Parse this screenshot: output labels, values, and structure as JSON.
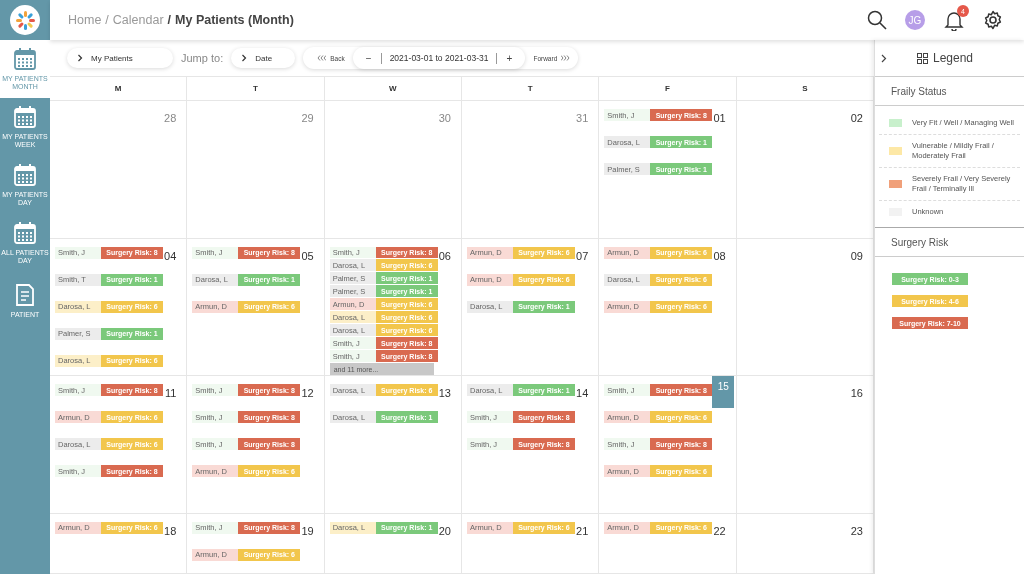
{
  "sidebar": {
    "items": [
      {
        "label": "MY PATIENTS MONTH",
        "selected": true,
        "kind": "calendar"
      },
      {
        "label": "MY PATIENTS WEEK",
        "selected": false,
        "kind": "calendar"
      },
      {
        "label": "MY PATIENTS DAY",
        "selected": false,
        "kind": "calendar"
      },
      {
        "label": "ALL PATIENTS DAY",
        "selected": false,
        "kind": "calendar"
      },
      {
        "label": "PATIENT",
        "selected": false,
        "kind": "document"
      }
    ]
  },
  "breadcrumb": [
    {
      "label": "Home",
      "current": false
    },
    {
      "separator": "/",
      "label": "Calendar",
      "current": false
    },
    {
      "separator": "/",
      "label": "My Patients (Month)",
      "current": true
    }
  ],
  "header": {
    "avatar": "JG",
    "notifications": "4"
  },
  "toolbar": {
    "view": "My Patients",
    "jump_label": "Jump to:",
    "jump": "Date",
    "back": "Back",
    "minus": "−",
    "range": "2021-03-01 to 2021-03-31",
    "plus": "+",
    "forward": "Forward"
  },
  "weekdays": [
    "M",
    "T",
    "W",
    "T",
    "F",
    "S"
  ],
  "weeks": [
    {
      "days": [
        {
          "date": "28",
          "muted": true,
          "today": false
        },
        {
          "date": "29",
          "muted": true,
          "today": false
        },
        {
          "date": "30",
          "muted": true,
          "today": false
        },
        {
          "date": "31",
          "muted": true,
          "today": false
        },
        {
          "date": "01",
          "muted": false,
          "today": false,
          "entries": [
            {
              "name": {
                "text": "Smith, J",
                "color": "#f0f9f0"
              },
              "risk": {
                "text": "Surgery Risk: 8",
                "color": "#d96a50"
              }
            },
            {
              "name": {
                "text": "Darosa, L",
                "color": "#ececec"
              },
              "risk": {
                "text": "Surgery Risk: 1",
                "color": "#7bc97b"
              }
            },
            {
              "name": {
                "text": "Palmer, S",
                "color": "#ececec"
              },
              "risk": {
                "text": "Surgery Risk: 1",
                "color": "#7bc97b"
              }
            }
          ]
        },
        {
          "date": "02",
          "muted": false,
          "today": false
        }
      ]
    },
    {
      "days": [
        {
          "date": "04",
          "muted": false,
          "today": false,
          "entries": [
            {
              "name": {
                "text": "Smith, J",
                "color": "#f0f9f0"
              },
              "risk": {
                "text": "Surgery Risk: 8",
                "color": "#d96a50"
              }
            },
            {
              "name": {
                "text": "Smith, T",
                "color": "#ececec"
              },
              "risk": {
                "text": "Surgery Risk: 1",
                "color": "#7bc97b"
              }
            },
            {
              "name": {
                "text": "Darosa, L",
                "color": "#fcefc8"
              },
              "risk": {
                "text": "Surgery Risk: 6",
                "color": "#f2c64c"
              }
            },
            {
              "name": {
                "text": "Palmer, S",
                "color": "#ececec"
              },
              "risk": {
                "text": "Surgery Risk: 1",
                "color": "#7bc97b"
              }
            },
            {
              "name": {
                "text": "Darosa, L",
                "color": "#fcefc8"
              },
              "risk": {
                "text": "Surgery Risk: 6",
                "color": "#f2c64c"
              }
            }
          ]
        },
        {
          "date": "05",
          "muted": false,
          "today": false,
          "entries": [
            {
              "name": {
                "text": "Smith, J",
                "color": "#f0f9f0"
              },
              "risk": {
                "text": "Surgery Risk: 8",
                "color": "#d96a50"
              }
            },
            {
              "name": {
                "text": "Darosa, L",
                "color": "#ececec"
              },
              "risk": {
                "text": "Surgery Risk: 1",
                "color": "#7bc97b"
              }
            },
            {
              "name": {
                "text": "Armun, D",
                "color": "#f9dad5"
              },
              "risk": {
                "text": "Surgery Risk: 6",
                "color": "#f2c64c"
              }
            }
          ]
        },
        {
          "date": "06",
          "muted": false,
          "today": false,
          "more": "and 11 more...",
          "entries": [
            {
              "name": {
                "text": "Smith, J",
                "color": "#f0f9f0"
              },
              "risk": {
                "text": "Surgery Risk: 8",
                "color": "#d96a50"
              }
            },
            {
              "name": {
                "text": "Darosa, L",
                "color": "#ececec"
              },
              "risk": {
                "text": "Surgery Risk: 6",
                "color": "#f2c64c"
              }
            },
            {
              "name": {
                "text": "Palmer, S",
                "color": "#ececec"
              },
              "risk": {
                "text": "Surgery Risk: 1",
                "color": "#7bc97b"
              }
            },
            {
              "name": {
                "text": "Palmer, S",
                "color": "#ececec"
              },
              "risk": {
                "text": "Surgery Risk: 1",
                "color": "#7bc97b"
              }
            },
            {
              "name": {
                "text": "Armun, D",
                "color": "#f9dad5"
              },
              "risk": {
                "text": "Surgery Risk: 6",
                "color": "#f2c64c"
              }
            },
            {
              "name": {
                "text": "Darosa, L",
                "color": "#fcefc8"
              },
              "risk": {
                "text": "Surgery Risk: 6",
                "color": "#f2c64c"
              }
            },
            {
              "name": {
                "text": "Darosa, L",
                "color": "#ececec"
              },
              "risk": {
                "text": "Surgery Risk: 6",
                "color": "#f2c64c"
              }
            },
            {
              "name": {
                "text": "Smith, J",
                "color": "#f0f9f0"
              },
              "risk": {
                "text": "Surgery Risk: 8",
                "color": "#d96a50"
              }
            },
            {
              "name": {
                "text": "Smith, J",
                "color": "#f0f9f0"
              },
              "risk": {
                "text": "Surgery Risk: 8",
                "color": "#d96a50"
              }
            }
          ]
        },
        {
          "date": "07",
          "muted": false,
          "today": false,
          "entries": [
            {
              "name": {
                "text": "Armun, D",
                "color": "#f9dad5"
              },
              "risk": {
                "text": "Surgery Risk: 6",
                "color": "#f2c64c"
              }
            },
            {
              "name": {
                "text": "Armun, D",
                "color": "#f9dad5"
              },
              "risk": {
                "text": "Surgery Risk: 6",
                "color": "#f2c64c"
              }
            },
            {
              "name": {
                "text": "Darosa, L",
                "color": "#ececec"
              },
              "risk": {
                "text": "Surgery Risk: 1",
                "color": "#7bc97b"
              }
            }
          ]
        },
        {
          "date": "08",
          "muted": false,
          "today": false,
          "entries": [
            {
              "name": {
                "text": "Armun, D",
                "color": "#f9dad5"
              },
              "risk": {
                "text": "Surgery Risk: 6",
                "color": "#f2c64c"
              }
            },
            {
              "name": {
                "text": "Darosa, L",
                "color": "#ececec"
              },
              "risk": {
                "text": "Surgery Risk: 6",
                "color": "#f2c64c"
              }
            },
            {
              "name": {
                "text": "Armun, D",
                "color": "#f9dad5"
              },
              "risk": {
                "text": "Surgery Risk: 6",
                "color": "#f2c64c"
              }
            }
          ]
        },
        {
          "date": "09",
          "muted": false,
          "today": false
        }
      ]
    },
    {
      "days": [
        {
          "date": "11",
          "muted": false,
          "today": false,
          "entries": [
            {
              "name": {
                "text": "Smith, J",
                "color": "#f0f9f0"
              },
              "risk": {
                "text": "Surgery Risk: 8",
                "color": "#d96a50"
              }
            },
            {
              "name": {
                "text": "Armun, D",
                "color": "#f9dad5"
              },
              "risk": {
                "text": "Surgery Risk: 6",
                "color": "#f2c64c"
              }
            },
            {
              "name": {
                "text": "Darosa, L",
                "color": "#ececec"
              },
              "risk": {
                "text": "Surgery Risk: 6",
                "color": "#f2c64c"
              }
            },
            {
              "name": {
                "text": "Smith, J",
                "color": "#f0f9f0"
              },
              "risk": {
                "text": "Surgery Risk: 8",
                "color": "#d96a50"
              }
            }
          ]
        },
        {
          "date": "12",
          "muted": false,
          "today": false,
          "entries": [
            {
              "name": {
                "text": "Smith, J",
                "color": "#f0f9f0"
              },
              "risk": {
                "text": "Surgery Risk: 8",
                "color": "#d96a50"
              }
            },
            {
              "name": {
                "text": "Smith, J",
                "color": "#f0f9f0"
              },
              "risk": {
                "text": "Surgery Risk: 8",
                "color": "#d96a50"
              }
            },
            {
              "name": {
                "text": "Smith, J",
                "color": "#f0f9f0"
              },
              "risk": {
                "text": "Surgery Risk: 8",
                "color": "#d96a50"
              }
            },
            {
              "name": {
                "text": "Armun, D",
                "color": "#f9dad5"
              },
              "risk": {
                "text": "Surgery Risk: 6",
                "color": "#f2c64c"
              }
            }
          ]
        },
        {
          "date": "13",
          "muted": false,
          "today": false,
          "entries": [
            {
              "name": {
                "text": "Darosa, L",
                "color": "#ececec"
              },
              "risk": {
                "text": "Surgery Risk: 6",
                "color": "#f2c64c"
              }
            },
            {
              "name": {
                "text": "Darosa, L",
                "color": "#ececec"
              },
              "risk": {
                "text": "Surgery Risk: 1",
                "color": "#7bc97b"
              }
            }
          ]
        },
        {
          "date": "14",
          "muted": false,
          "today": false,
          "entries": [
            {
              "name": {
                "text": "Darosa, L",
                "color": "#ececec"
              },
              "risk": {
                "text": "Surgery Risk: 1",
                "color": "#7bc97b"
              }
            },
            {
              "name": {
                "text": "Smith, J",
                "color": "#f0f9f0"
              },
              "risk": {
                "text": "Surgery Risk: 8",
                "color": "#d96a50"
              }
            },
            {
              "name": {
                "text": "Smith, J",
                "color": "#f0f9f0"
              },
              "risk": {
                "text": "Surgery Risk: 8",
                "color": "#d96a50"
              }
            }
          ]
        },
        {
          "date": "15",
          "muted": false,
          "today": true,
          "entries": [
            {
              "name": {
                "text": "Smith, J",
                "color": "#f0f9f0"
              },
              "risk": {
                "text": "Surgery Risk: 8",
                "color": "#d96a50"
              }
            },
            {
              "name": {
                "text": "Armun, D",
                "color": "#f9dad5"
              },
              "risk": {
                "text": "Surgery Risk: 6",
                "color": "#f2c64c"
              }
            },
            {
              "name": {
                "text": "Smith, J",
                "color": "#f0f9f0"
              },
              "risk": {
                "text": "Surgery Risk: 8",
                "color": "#d96a50"
              }
            },
            {
              "name": {
                "text": "Armun, D",
                "color": "#f9dad5"
              },
              "risk": {
                "text": "Surgery Risk: 6",
                "color": "#f2c64c"
              }
            }
          ]
        },
        {
          "date": "16",
          "muted": false,
          "today": false
        }
      ]
    },
    {
      "days": [
        {
          "date": "18",
          "muted": false,
          "today": false,
          "entries": [
            {
              "name": {
                "text": "Armun, D",
                "color": "#f9dad5"
              },
              "risk": {
                "text": "Surgery Risk: 6",
                "color": "#f2c64c"
              }
            }
          ]
        },
        {
          "date": "19",
          "muted": false,
          "today": false,
          "entries": [
            {
              "name": {
                "text": "Smith, J",
                "color": "#f0f9f0"
              },
              "risk": {
                "text": "Surgery Risk: 8",
                "color": "#d96a50"
              }
            },
            {
              "name": {
                "text": "Armun, D",
                "color": "#f9dad5"
              },
              "risk": {
                "text": "Surgery Risk: 6",
                "color": "#f2c64c"
              }
            }
          ]
        },
        {
          "date": "20",
          "muted": false,
          "today": false,
          "entries": [
            {
              "name": {
                "text": "Darosa, L",
                "color": "#fcefc8"
              },
              "risk": {
                "text": "Surgery Risk: 1",
                "color": "#7bc97b"
              }
            }
          ]
        },
        {
          "date": "21",
          "muted": false,
          "today": false,
          "entries": [
            {
              "name": {
                "text": "Armun, D",
                "color": "#f9dad5"
              },
              "risk": {
                "text": "Surgery Risk: 6",
                "color": "#f2c64c"
              }
            }
          ]
        },
        {
          "date": "22",
          "muted": false,
          "today": false,
          "entries": [
            {
              "name": {
                "text": "Armun, D",
                "color": "#f9dad5"
              },
              "risk": {
                "text": "Surgery Risk: 6",
                "color": "#f2c64c"
              }
            }
          ]
        },
        {
          "date": "23",
          "muted": false,
          "today": false
        }
      ]
    }
  ],
  "legend": {
    "title": "Legend",
    "frailty_title": "Fraily Status",
    "frailty": [
      {
        "label": "Very Fit / Well / Managing Well",
        "color": "#c8f0cc"
      },
      {
        "label": "Vulnerable / Mildly Frail / Moderately Frail",
        "color": "#fde8a6"
      },
      {
        "label": "Severely Frail / Very Severely Frail / Terminally Ill",
        "color": "#f0a07a"
      },
      {
        "label": "Unknown",
        "color": "#f2f2f2"
      }
    ],
    "risk_title": "Surgery Risk",
    "risk": [
      {
        "label": "Surgery Risk: 0-3",
        "color": "#7bc97b"
      },
      {
        "label": "Surgery Risk: 4-6",
        "color": "#f2c64c"
      },
      {
        "label": "Surgery Risk: 7-10",
        "color": "#d96a50"
      }
    ]
  }
}
